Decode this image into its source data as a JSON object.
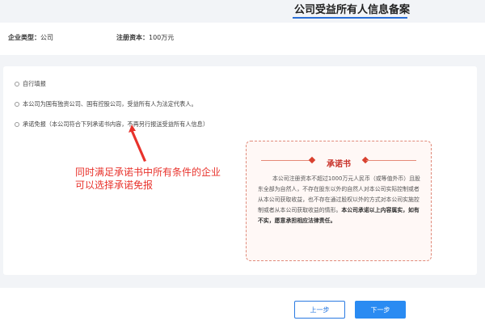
{
  "header": {
    "title": "公司受益所有人信息备案"
  },
  "info": {
    "company_type_label": "企业类型：",
    "company_type_value": "公司",
    "capital_label": "注册资本：",
    "capital_value": "100万元"
  },
  "options": [
    {
      "label": "自行填报",
      "selected": false
    },
    {
      "label": "本公司为国有独资公司、国有控股公司，受益所有人为法定代表人。",
      "selected": false
    },
    {
      "label": "承诺免报（本公司符合下列承诺书内容，不再另行报送受益所有人信息）",
      "selected": false
    }
  ],
  "annotation": {
    "line1": "同时满足承诺书中所有条件的企业",
    "line2": "可以选择承诺免报",
    "color": "#e8322b"
  },
  "pledge": {
    "heading": "承诺书",
    "body_normal": "本公司注册资本不超过1000万元人民币（或等值外币）且股东全部为自然人，不存在股东以外的自然人对本公司实际控制或者从本公司获取收益，也不存在通过股权以外的方式对本公司实施控制或者从本公司获取收益的情形。",
    "body_bold": "本公司承诺以上内容属实，如有不实，愿意承担相应法律责任。"
  },
  "footer": {
    "prev_label": "上一步",
    "next_label": "下一步"
  },
  "colors": {
    "accent": "#2a8bf2",
    "pledge_red": "#c8322a"
  }
}
